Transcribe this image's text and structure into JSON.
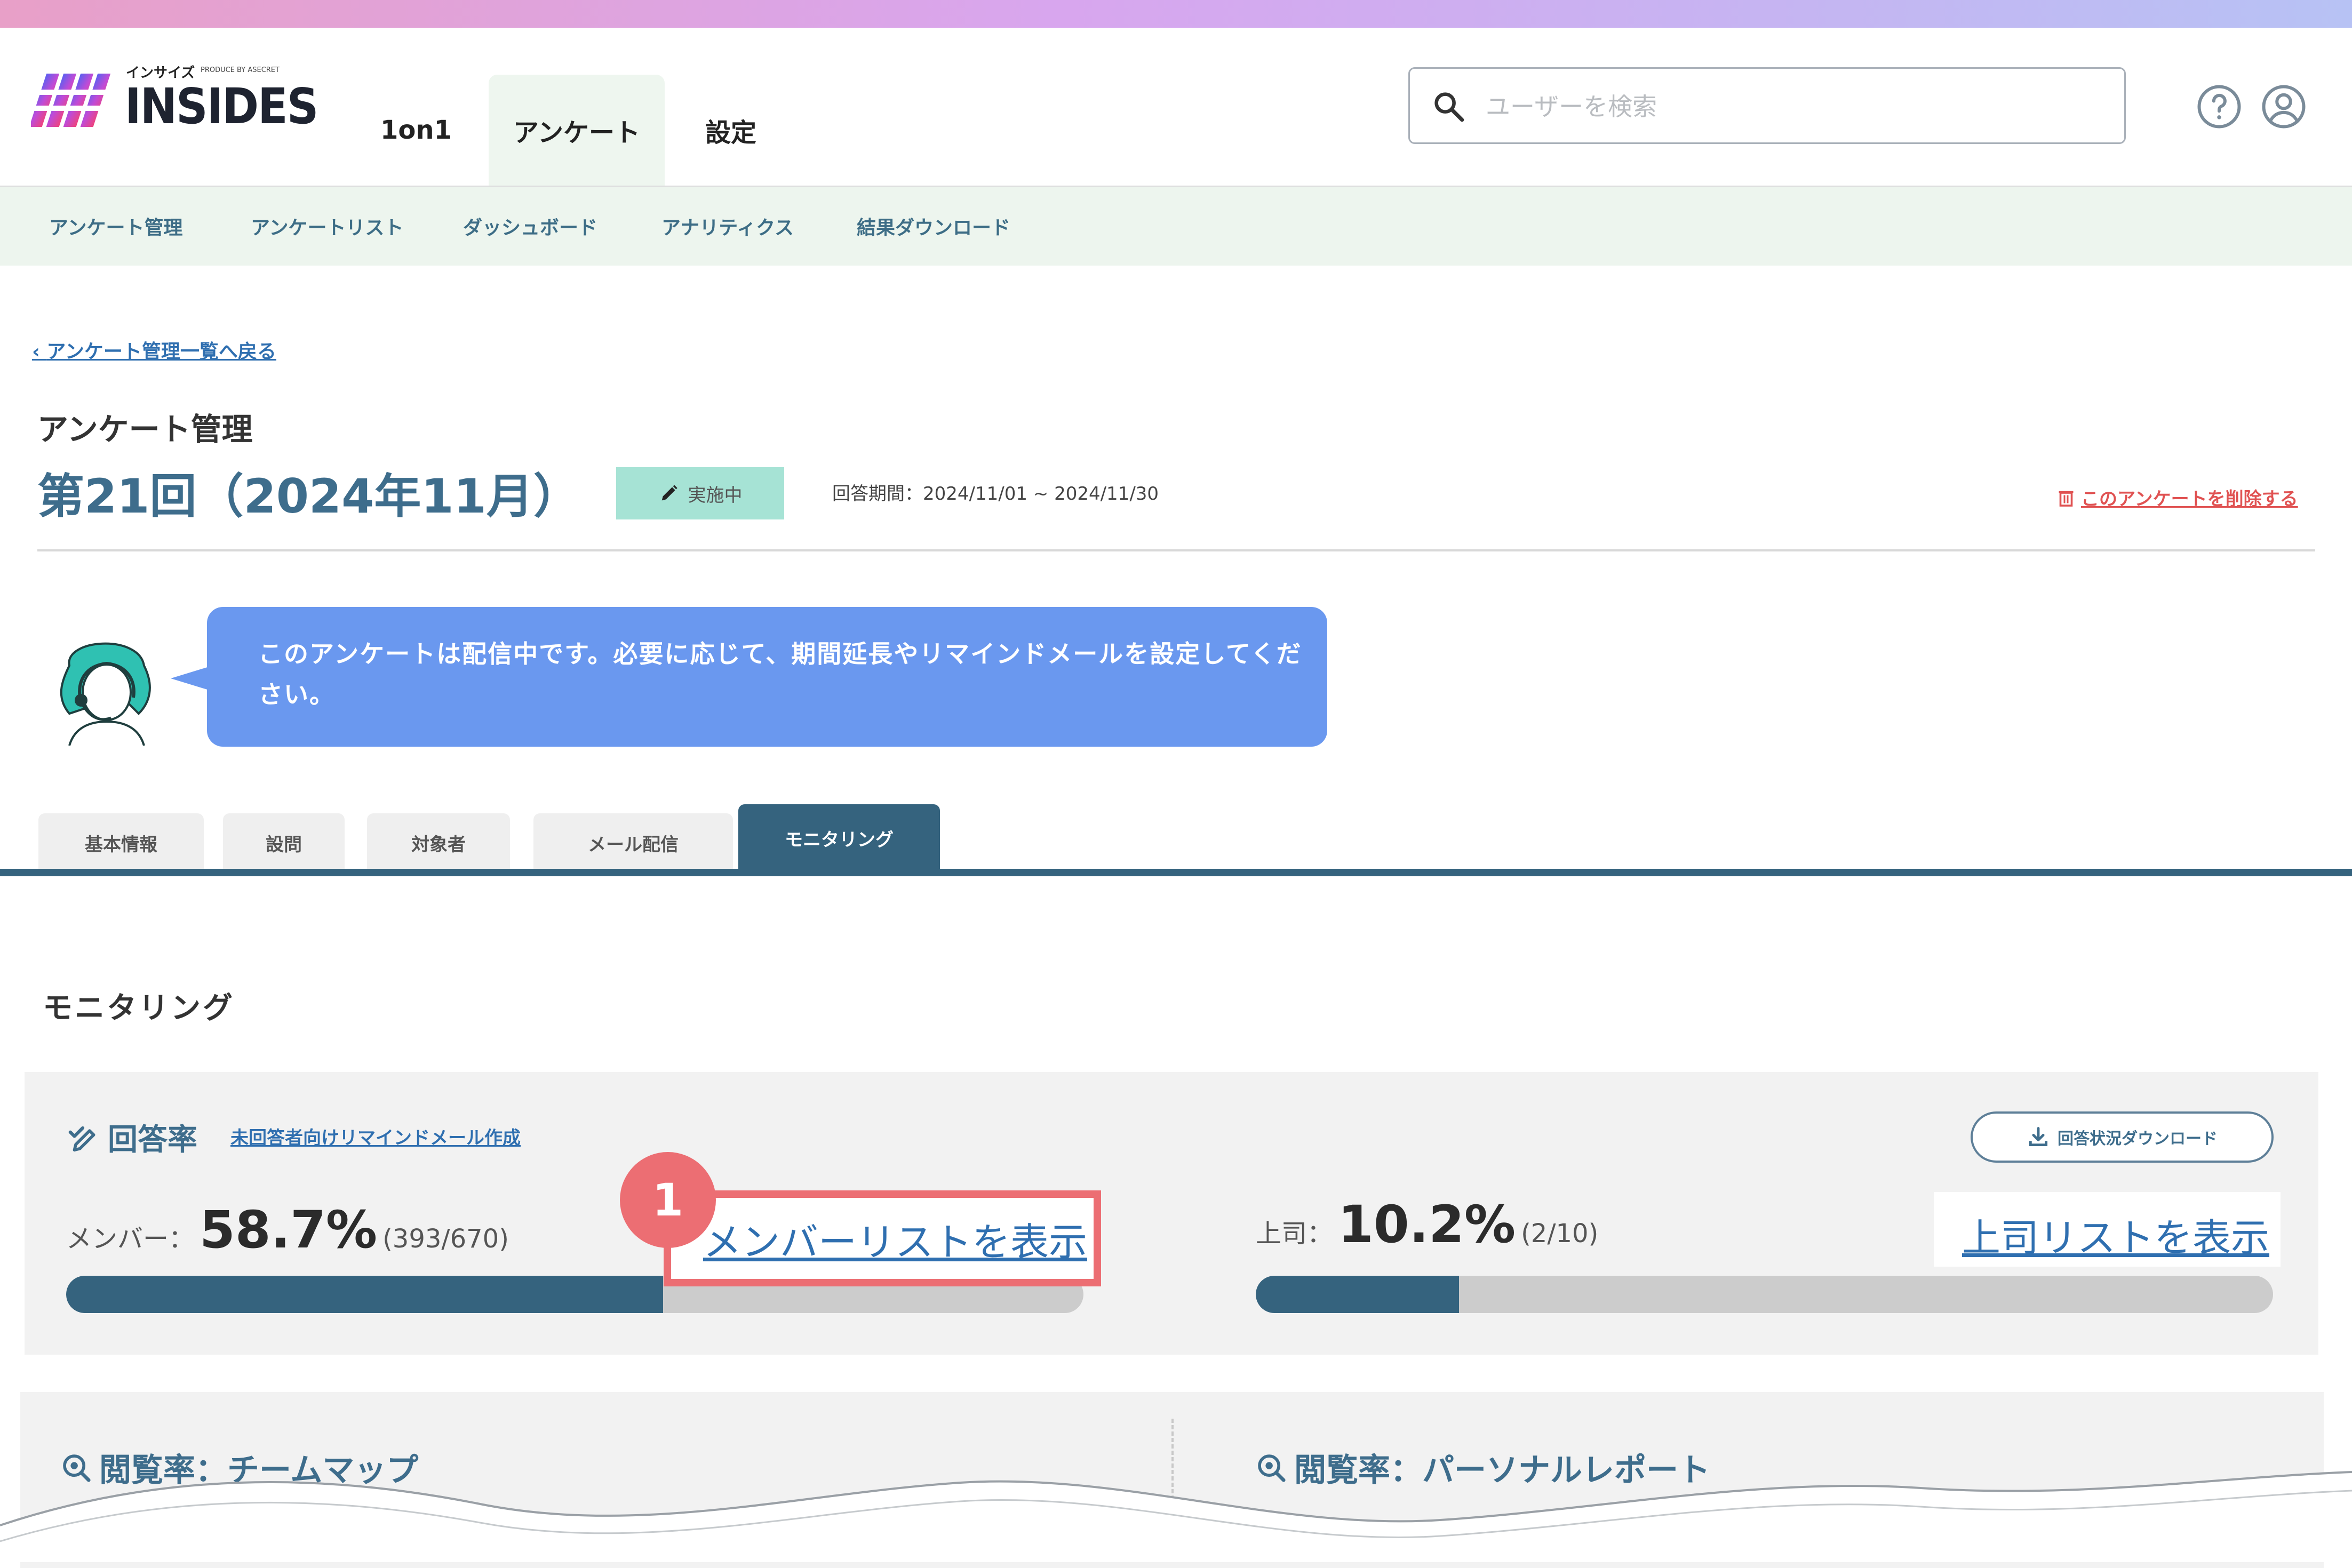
{
  "brand": {
    "logo_text": "INSIDES",
    "logo_sub": "インサイズ",
    "produced_by": "PRODUCE BY ASECRET"
  },
  "nav": {
    "items": [
      "1on1",
      "アンケート",
      "設定"
    ],
    "active": "アンケート"
  },
  "search": {
    "placeholder": "ユーザーを検索"
  },
  "header_icons": [
    "help-icon",
    "user-account-icon"
  ],
  "subnav": {
    "items": [
      "アンケート管理",
      "アンケートリスト",
      "ダッシュボード",
      "アナリティクス",
      "結果ダウンロード"
    ]
  },
  "page": {
    "back_link": "アンケート管理一覧へ戻る",
    "section_label": "アンケート管理",
    "title": "第21回（2024年11月）",
    "status": "実施中",
    "period": "回答期間：2024/11/01 ~ 2024/11/30",
    "delete_link": "このアンケートを削除する"
  },
  "message": {
    "text": "このアンケートは配信中です。必要に応じて、期間延長やリマインドメールを設定してください。"
  },
  "tabs": {
    "items": [
      "基本情報",
      "設問",
      "対象者",
      "メール配信",
      "モニタリング"
    ],
    "active": "モニタリング"
  },
  "monitoring": {
    "heading": "モニタリング",
    "response_rate": {
      "title": "回答率",
      "remind_link": "未回答者向けリマインドメール作成",
      "download_button": "回答状況ダウンロード",
      "member": {
        "label": "メンバー：",
        "value": "58.7%",
        "count": "(393/670)",
        "fraction": 0.587,
        "list_link": "メンバーリストを表示"
      },
      "boss": {
        "label": "上司：",
        "value": "10.2%",
        "count": "(2/10)",
        "fraction": 0.2,
        "list_link": "上司リストを表示"
      }
    },
    "view_rate_team": "閲覧率：チームマップ",
    "view_rate_personal": "閲覧率：パーソナルレポート"
  },
  "annotation": {
    "step": "1"
  },
  "colors": {
    "primary": "#35637e",
    "accent_red": "#ec6e73",
    "link": "#2f6fb0",
    "bubble": "#6a98ef",
    "badge": "#a6e3d5"
  }
}
